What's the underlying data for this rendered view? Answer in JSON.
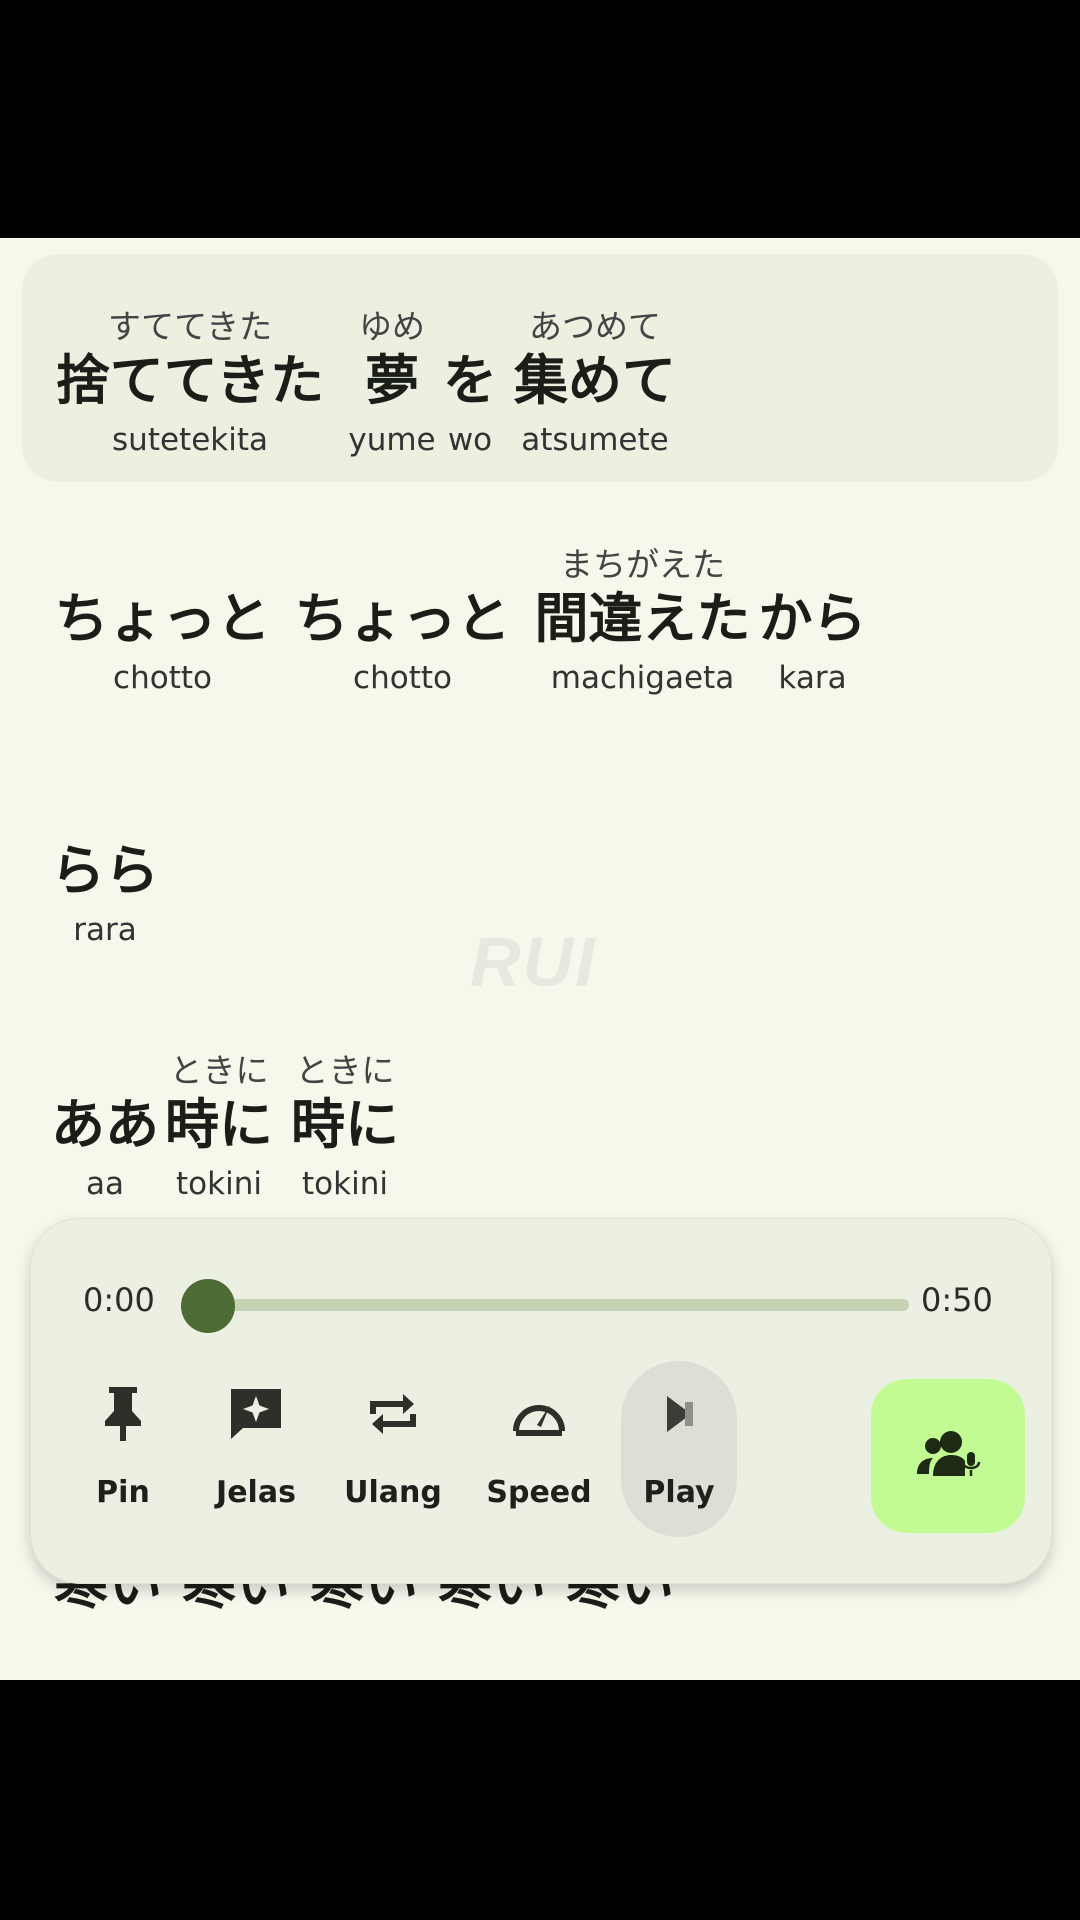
{
  "lyrics": [
    {
      "active": true,
      "words": [
        {
          "furigana": "すててきた",
          "text": "捨ててきた",
          "romaji": "sutetekita"
        },
        {
          "furigana": "ゆめ",
          "text": "夢",
          "romaji": "yume"
        },
        {
          "furigana": "",
          "text": "を",
          "romaji": "wo"
        },
        {
          "furigana": "あつめて",
          "text": "集めて",
          "romaji": "atsumete"
        }
      ]
    },
    {
      "active": false,
      "words": [
        {
          "furigana": "",
          "text": "ちょっと",
          "romaji": "chotto"
        },
        {
          "furigana": "",
          "text": "ちょっと",
          "romaji": "chotto"
        },
        {
          "furigana": "まちがえた",
          "text": "間違えた",
          "romaji": "machigaeta"
        },
        {
          "furigana": "",
          "text": "から",
          "romaji": "kara"
        }
      ]
    },
    {
      "active": false,
      "words": [
        {
          "furigana": "",
          "text": "らら",
          "romaji": "rara"
        }
      ]
    },
    {
      "active": false,
      "words": [
        {
          "furigana": "",
          "text": "ああ",
          "romaji": "aa"
        },
        {
          "furigana": "ときに",
          "text": "時に",
          "romaji": "tokini"
        },
        {
          "furigana": "ときに",
          "text": "時に",
          "romaji": "tokini"
        }
      ]
    },
    {
      "active": false,
      "words": [
        {
          "furigana": "",
          "text": "寒い"
        },
        {
          "furigana": "",
          "text": "寒い"
        },
        {
          "furigana": "",
          "text": "寒い"
        },
        {
          "furigana": "",
          "text": "寒い"
        },
        {
          "furigana": "",
          "text": "寒い"
        }
      ]
    }
  ],
  "watermark": "RUI",
  "player": {
    "current_time": "0:00",
    "total_time": "0:50",
    "progress": 0.0,
    "controls": [
      {
        "label": "Pin",
        "icon": "pin-icon"
      },
      {
        "label": "Jelas",
        "icon": "sparkle-message-icon"
      },
      {
        "label": "Ulang",
        "icon": "repeat-icon"
      },
      {
        "label": "Speed",
        "icon": "speedometer-icon"
      },
      {
        "label": "Play",
        "icon": "play-icon"
      }
    ],
    "voice_button_icon": "group-microphone-icon"
  },
  "colors": {
    "background": "#f6f8ec",
    "active_card": "#ebf0e1",
    "thumb": "#4d6b34",
    "track": "#c6d2b4",
    "voice_button": "#c2fa93"
  }
}
